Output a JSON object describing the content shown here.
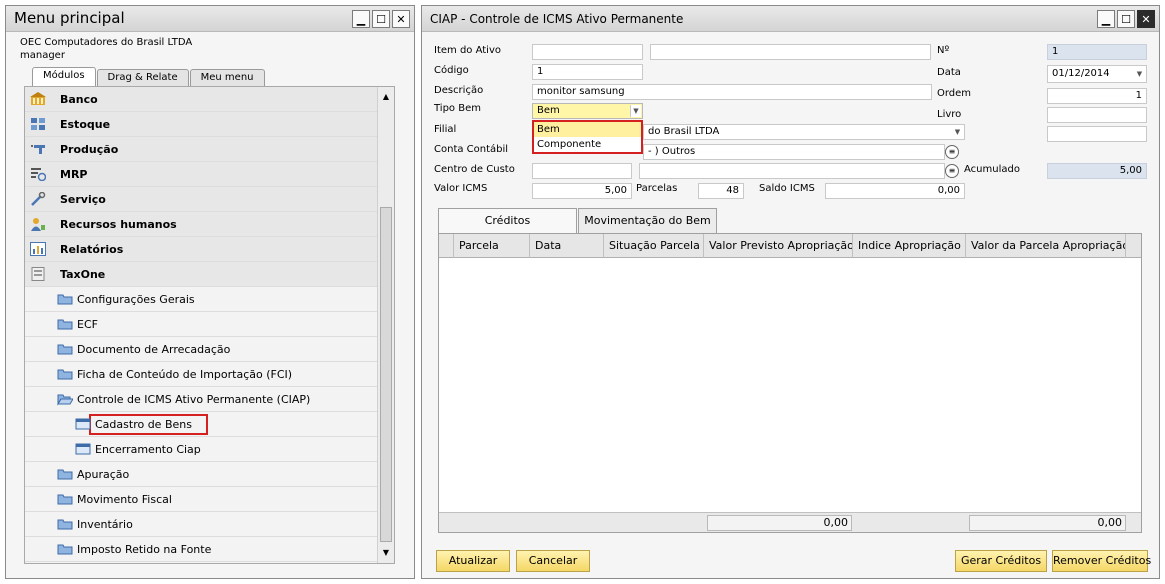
{
  "menu_window": {
    "title": "Menu principal",
    "company": "OEC Computadores do Brasil LTDA",
    "user": "manager",
    "tabs": [
      {
        "label": "Módulos",
        "active": true
      },
      {
        "label": "Drag & Relate",
        "active": false
      },
      {
        "label": "Meu menu",
        "active": false
      }
    ],
    "modules": [
      {
        "label": "Banco",
        "icon": "bank-icon"
      },
      {
        "label": "Estoque",
        "icon": "inventory-icon"
      },
      {
        "label": "Produção",
        "icon": "production-icon"
      },
      {
        "label": "MRP",
        "icon": "mrp-icon"
      },
      {
        "label": "Serviço",
        "icon": "service-icon"
      },
      {
        "label": "Recursos humanos",
        "icon": "hr-icon"
      },
      {
        "label": "Relatórios",
        "icon": "reports-icon"
      },
      {
        "label": "TaxOne",
        "icon": "taxone-icon"
      }
    ],
    "taxone_items": [
      {
        "label": "Configurações Gerais"
      },
      {
        "label": "ECF"
      },
      {
        "label": "Documento de Arrecadação"
      },
      {
        "label": "Ficha de Conteúdo de Importação (FCI)"
      },
      {
        "label": "Controle de ICMS Ativo Permanente (CIAP)"
      },
      {
        "label": "Cadastro de Bens",
        "sub": true,
        "selected": true
      },
      {
        "label": "Encerramento Ciap",
        "sub": true
      },
      {
        "label": "Apuração"
      },
      {
        "label": "Movimento Fiscal"
      },
      {
        "label": "Inventário"
      },
      {
        "label": "Imposto Retido na Fonte"
      }
    ]
  },
  "ciap_window": {
    "title": "CIAP - Controle de ICMS Ativo Permanente",
    "fields": {
      "item_do_ativo": {
        "label": "Item do Ativo",
        "value": "",
        "value2": ""
      },
      "codigo": {
        "label": "Código",
        "value": "1"
      },
      "descricao": {
        "label": "Descrição",
        "value": "monitor samsung"
      },
      "tipo_bem": {
        "label": "Tipo Bem",
        "value": "Bem"
      },
      "filial": {
        "label": "Filial",
        "value": "do Brasil LTDA"
      },
      "conta_contabil": {
        "label": "Conta Contábil",
        "value": "- ) Outros"
      },
      "centro_de_custo": {
        "label": "Centro de Custo",
        "value": ""
      },
      "valor_icms": {
        "label": "Valor ICMS",
        "value": "5,00"
      },
      "parcelas": {
        "label": "Parcelas",
        "value": "48"
      },
      "saldo_icms": {
        "label": "Saldo ICMS",
        "value": "0,00"
      },
      "numero": {
        "label": "Nº",
        "value": "1"
      },
      "data": {
        "label": "Data",
        "value": "01/12/2014"
      },
      "ordem": {
        "label": "Ordem",
        "value": "1"
      },
      "livro": {
        "label": "Livro",
        "value": ""
      },
      "extra": {
        "value": ""
      },
      "acumulado": {
        "label": "Acumulado",
        "value": "5,00"
      }
    },
    "tipo_bem_options": [
      "Bem",
      "Componente"
    ],
    "tabs": [
      {
        "label": "Créditos",
        "active": true
      },
      {
        "label": "Movimentação do Bem",
        "active": false
      }
    ],
    "grid": {
      "columns": [
        "Parcela",
        "Data",
        "Situação Parcela",
        "Valor Previsto Apropriação",
        "Indice Apropriação",
        "Valor da Parcela Apropriação"
      ],
      "totals": [
        "0,00",
        "0,00"
      ]
    },
    "buttons": {
      "atualizar": "Atualizar",
      "cancelar": "Cancelar",
      "gerar": "Gerar Créditos",
      "remover": "Remover Créditos"
    }
  },
  "colors": {
    "button_bg": "#f5d766",
    "highlight_border": "#d42020",
    "readonly_field": "#dbe4ee"
  }
}
